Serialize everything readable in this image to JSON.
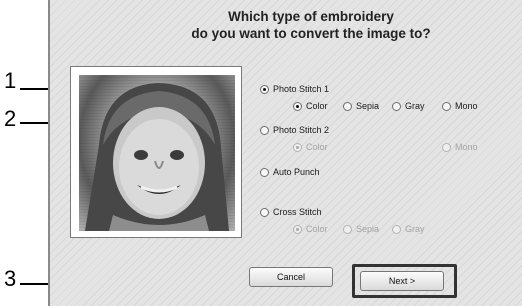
{
  "dialog": {
    "title_line1": "Which type of embroidery",
    "title_line2": "do you want to convert the image to?"
  },
  "options": {
    "photo_stitch_1": {
      "label": "Photo Stitch 1",
      "selected": true
    },
    "ps1_colors": [
      {
        "label": "Color",
        "selected": true
      },
      {
        "label": "Sepia",
        "selected": false
      },
      {
        "label": "Gray",
        "selected": false
      },
      {
        "label": "Mono",
        "selected": false
      }
    ],
    "photo_stitch_2": {
      "label": "Photo Stitch 2",
      "selected": false
    },
    "ps2_colors": [
      {
        "label": "Color",
        "selected": true,
        "enabled": false
      },
      {
        "label": "Mono",
        "selected": false,
        "enabled": false
      }
    ],
    "auto_punch": {
      "label": "Auto Punch",
      "selected": false
    },
    "cross_stitch": {
      "label": "Cross Stitch",
      "selected": false
    },
    "cs_colors": [
      {
        "label": "Color",
        "selected": true,
        "enabled": false
      },
      {
        "label": "Sepia",
        "selected": false,
        "enabled": false
      },
      {
        "label": "Gray",
        "selected": false,
        "enabled": false
      }
    ]
  },
  "buttons": {
    "cancel_label": "Cancel",
    "next_label": "Next >"
  },
  "callouts": [
    "1",
    "2",
    "3"
  ]
}
